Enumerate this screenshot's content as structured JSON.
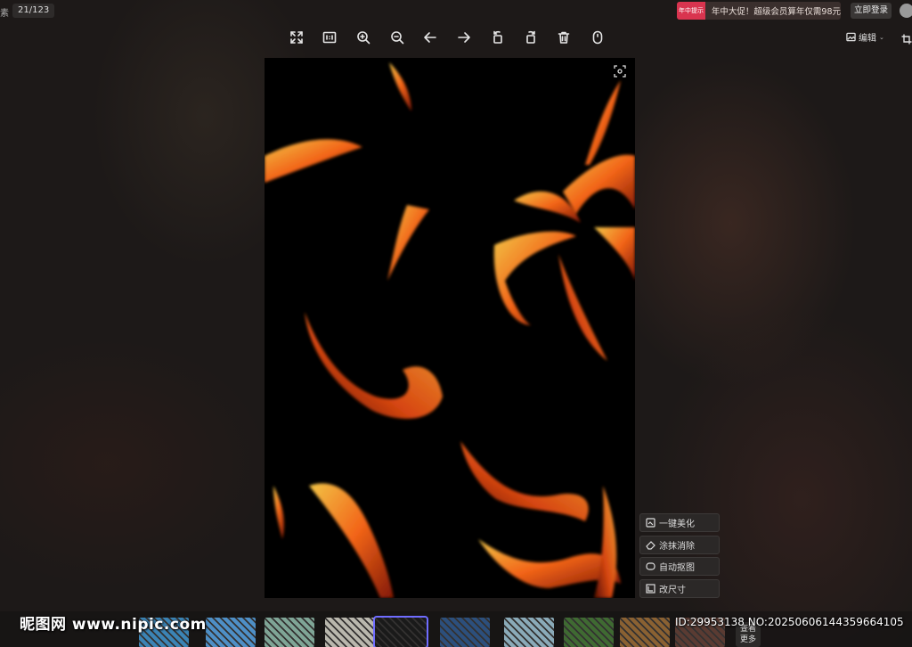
{
  "header": {
    "left_fragment": "素",
    "counter": "21/123",
    "promo_badge": "年中提示",
    "promo_text": "年中大促！超级会员算年仅需98元",
    "login": "立即登录"
  },
  "toolbar": {
    "icons": [
      "fullscreen-icon",
      "original-size-icon",
      "zoom-in-icon",
      "zoom-out-icon",
      "arrow-left-icon",
      "arrow-right-icon",
      "rotate-left-icon",
      "rotate-right-icon",
      "delete-icon",
      "mouse-icon"
    ],
    "edit_label": "编辑"
  },
  "side_tools": [
    {
      "label": "一键美化",
      "icon": "beautify-icon"
    },
    {
      "label": "涂抹消除",
      "icon": "eraser-icon"
    },
    {
      "label": "自动抠图",
      "icon": "cutout-icon"
    },
    {
      "label": "改尺寸",
      "icon": "resize-icon"
    }
  ],
  "thumbnails": {
    "colors": [
      "#3b84b5",
      "#4e8fc6",
      "#7fa596",
      "#b9b7ad",
      "#1a1a1a",
      "#2c4f7c",
      "#8aaab8",
      "#3f6a32",
      "#8a6132",
      "#5a3b32"
    ],
    "active_index": 4,
    "more_label": "查看\n更多"
  },
  "watermark": {
    "brand": "昵图网 www.nipic.com",
    "id_text": "ID:29953138 NO:20250606144359664105"
  }
}
